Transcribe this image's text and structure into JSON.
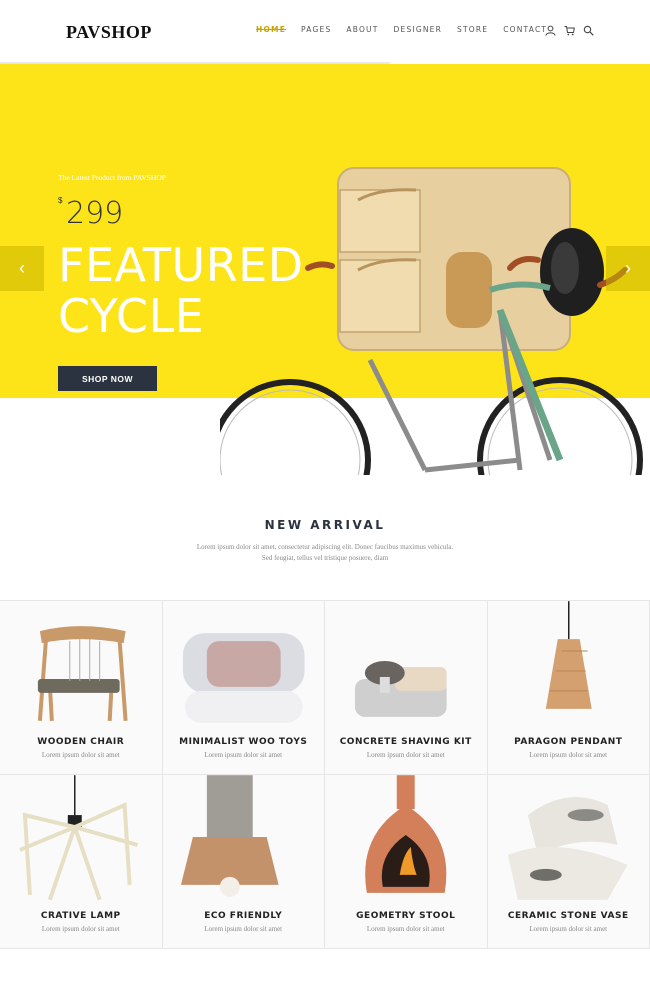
{
  "header": {
    "logo": "PAVSHOP",
    "nav": [
      "HOME",
      "PAGES",
      "ABOUT",
      "DESIGNER",
      "STORE",
      "CONTACT"
    ],
    "active_nav": "HOME",
    "icons": [
      "user-icon",
      "cart-icon",
      "search-icon"
    ]
  },
  "hero": {
    "subtitle": "The Latest Product from PAVSHOP",
    "currency": "$",
    "price": "299",
    "title_line1": "FEATURED",
    "title_line2": "CYCLE",
    "button": "SHOP NOW",
    "prev": "‹",
    "next": "›",
    "bg_color": "#fce418"
  },
  "arrival": {
    "title": "NEW ARRIVAL",
    "desc_line1": "Lorem ipsum dolor sit amet, consectetur adipiscing elit. Donec faucibus maximus vehicula.",
    "desc_line2": "Sed feugiat, tellus vel tristique posuere, diam"
  },
  "products": [
    {
      "name": "WOODEN CHAIR",
      "desc": "Lorem ipsum dolor sit amet"
    },
    {
      "name": "MINIMALIST WOO TOYS",
      "desc": "Lorem ipsum dolor sit amet"
    },
    {
      "name": "CONCRETE SHAVING KIT",
      "desc": "Lorem ipsum dolor sit amet"
    },
    {
      "name": "PARAGON PENDANT",
      "desc": "Lorem ipsum dolor sit amet"
    },
    {
      "name": "CRATIVE LAMP",
      "desc": "Lorem ipsum dolor sit amet"
    },
    {
      "name": "ECO FRIENDLY",
      "desc": "Lorem ipsum dolor sit amet"
    },
    {
      "name": "GEOMETRY STOOL",
      "desc": "Lorem ipsum dolor sit amet"
    },
    {
      "name": "CERAMIC STONE VASE",
      "desc": "Lorem ipsum dolor sit amet"
    }
  ]
}
